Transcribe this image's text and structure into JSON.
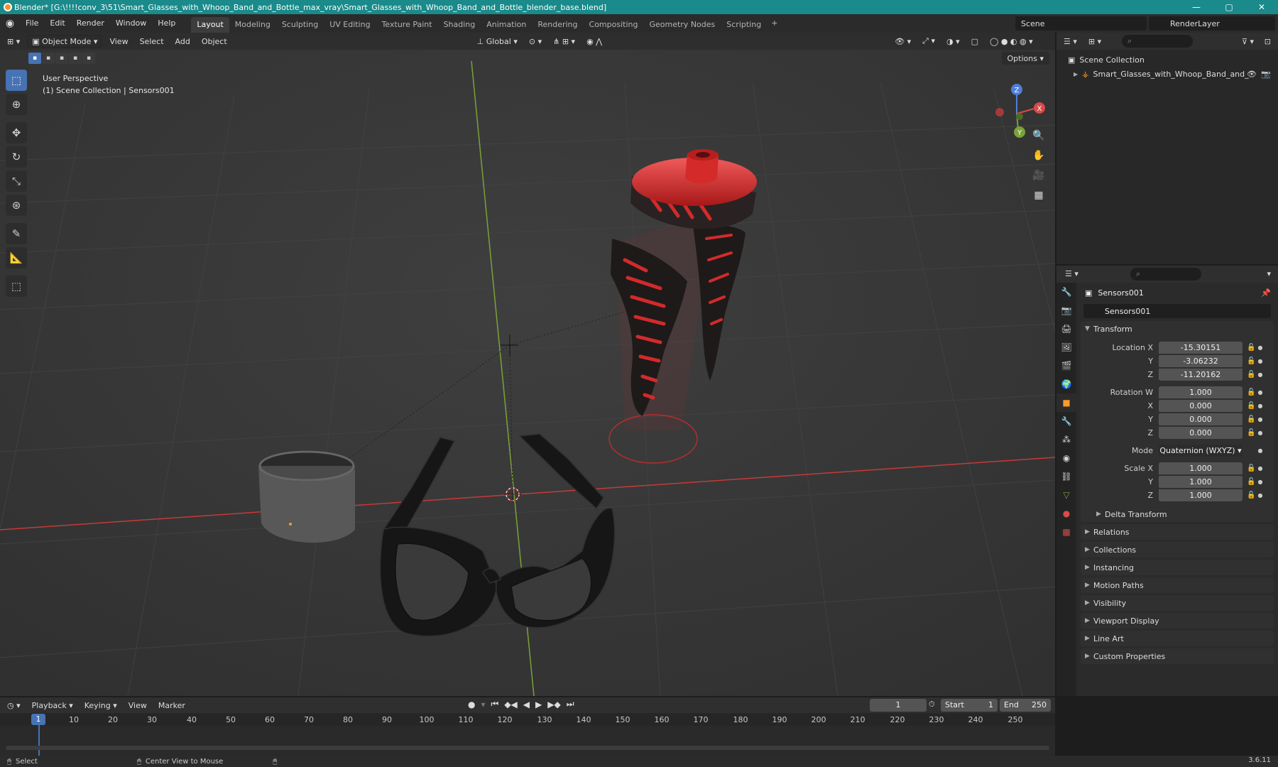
{
  "window": {
    "title": "Blender* [G:\\!!!!conv_3\\51\\Smart_Glasses_with_Whoop_Band_and_Bottle_max_vray\\Smart_Glasses_with_Whoop_Band_and_Bottle_blender_base.blend]",
    "controls": [
      "—",
      "▢",
      "✕"
    ]
  },
  "menu": [
    "File",
    "Edit",
    "Render",
    "Window",
    "Help"
  ],
  "workspaces": [
    "Layout",
    "Modeling",
    "Sculpting",
    "UV Editing",
    "Texture Paint",
    "Shading",
    "Animation",
    "Rendering",
    "Compositing",
    "Geometry Nodes",
    "Scripting"
  ],
  "workspace_add": "+",
  "scene": "Scene",
  "render_layer": "RenderLayer",
  "viewport": {
    "mode": "Object Mode",
    "menus": [
      "View",
      "Select",
      "Add",
      "Object"
    ],
    "orientation": "Global",
    "options": "Options",
    "perspective": "User Perspective",
    "collection_info": "(1) Scene Collection | Sensors001",
    "gizmo": {
      "x": "X",
      "y": "Y",
      "z": "Z"
    }
  },
  "outliner": {
    "search_placeholder": "",
    "root": "Scene Collection",
    "child": "Smart_Glasses_with_Whoop_Band_and_"
  },
  "properties": {
    "object_name": "Sensors001",
    "data_name": "Sensors001",
    "transform": {
      "header": "Transform",
      "location_label": "Location X",
      "location": [
        "-15.30151",
        "-3.06232",
        "-11.20162"
      ],
      "rotation_label": "Rotation W",
      "rotation": [
        "1.000",
        "0.000",
        "0.000",
        "0.000"
      ],
      "mode_label": "Mode",
      "mode": "Quaternion (WXYZ)",
      "scale_label": "Scale X",
      "scale": [
        "1.000",
        "1.000",
        "1.000"
      ],
      "axis_y": "Y",
      "axis_z": "Z",
      "axis_x": "X",
      "delta": "Delta Transform"
    },
    "panels": [
      "Relations",
      "Collections",
      "Instancing",
      "Motion Paths",
      "Visibility",
      "Viewport Display",
      "Line Art",
      "Custom Properties"
    ]
  },
  "timeline": {
    "menus": [
      "Playback",
      "Keying",
      "View",
      "Marker"
    ],
    "current_frame": "1",
    "start_label": "Start",
    "start": "1",
    "end_label": "End",
    "end": "250",
    "ticks": [
      "10",
      "20",
      "30",
      "40",
      "50",
      "60",
      "70",
      "80",
      "90",
      "100",
      "110",
      "120",
      "130",
      "140",
      "150",
      "160",
      "170",
      "180",
      "190",
      "200",
      "210",
      "220",
      "230",
      "240",
      "250"
    ],
    "playhead": "1"
  },
  "status": {
    "select": "Select",
    "center": "Center View to Mouse",
    "version": "3.6.11"
  },
  "colors": {
    "titlebar": "#1a8a8a",
    "accent": "#4772b3",
    "bottle_red": "#d42a2a",
    "x_axis": "#c63a3a",
    "y_axis": "#7aa23a"
  }
}
